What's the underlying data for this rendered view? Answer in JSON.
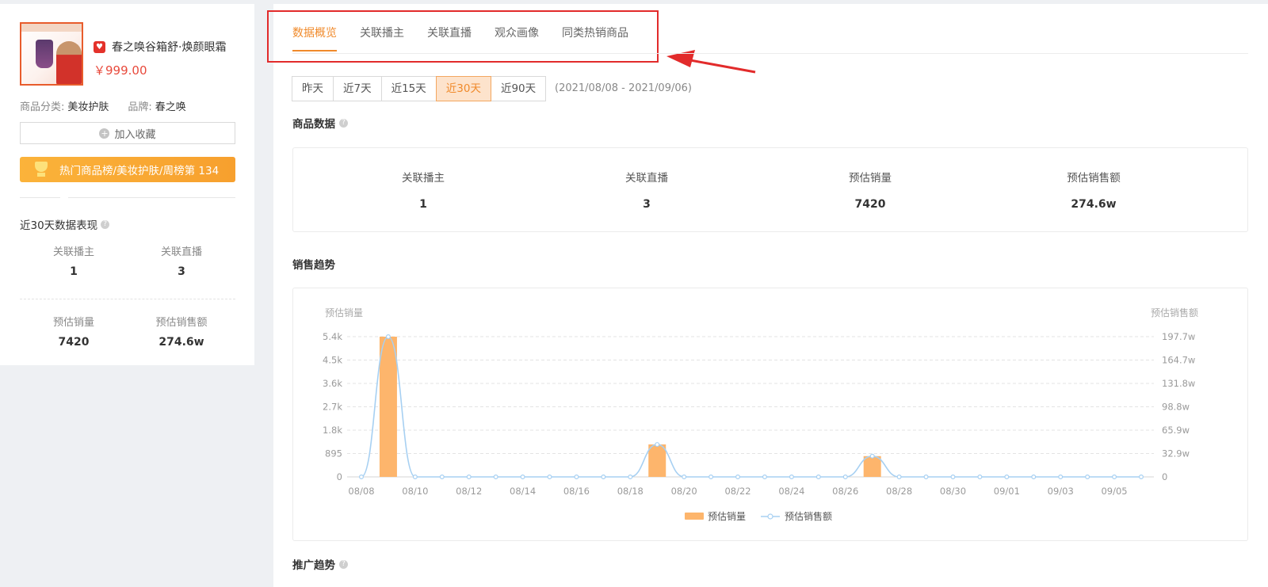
{
  "product": {
    "name": "春之唤谷箱舒·焕颜眼霜",
    "price": "￥999.00",
    "category_label": "商品分类:",
    "category_value": "美妆护肤",
    "brand_label": "品牌:",
    "brand_value": "春之唤",
    "favorite_label": "加入收藏",
    "rank_text": "热门商品榜/美妆护肤/周榜第 134"
  },
  "sidebar_stats": {
    "title": "近30天数据表现",
    "items": [
      {
        "label": "关联播主",
        "value": "1"
      },
      {
        "label": "关联直播",
        "value": "3"
      },
      {
        "label": "预估销量",
        "value": "7420"
      },
      {
        "label": "预估销售额",
        "value": "274.6w"
      }
    ]
  },
  "tabs": [
    {
      "label": "数据概览",
      "active": true
    },
    {
      "label": "关联播主",
      "active": false
    },
    {
      "label": "关联直播",
      "active": false
    },
    {
      "label": "观众画像",
      "active": false
    },
    {
      "label": "同类热销商品",
      "active": false
    }
  ],
  "date_filters": [
    {
      "label": "昨天",
      "active": false
    },
    {
      "label": "近7天",
      "active": false
    },
    {
      "label": "近15天",
      "active": false
    },
    {
      "label": "近30天",
      "active": true
    },
    {
      "label": "近90天",
      "active": false
    }
  ],
  "date_range": "(2021/08/08 - 2021/09/06)",
  "product_data": {
    "title": "商品数据",
    "items": [
      {
        "label": "关联播主",
        "value": "1"
      },
      {
        "label": "关联直播",
        "value": "3"
      },
      {
        "label": "预估销量",
        "value": "7420"
      },
      {
        "label": "预估销售额",
        "value": "274.6w"
      }
    ]
  },
  "sales_trend_title": "销售趋势",
  "promo_trend_title": "推广趋势",
  "colors": {
    "accent": "#f08a2b",
    "bar": "#fdb56c",
    "line": "#a7d0f2",
    "highlight": "#e22b2b"
  },
  "chart_data": {
    "type": "bar",
    "title": "",
    "ylabel": "预估销量",
    "ylabel_right": "预估销售额",
    "ylim": [
      0,
      5400
    ],
    "y_ticks": [
      "0",
      "895",
      "1.8k",
      "2.7k",
      "3.6k",
      "4.5k",
      "5.4k"
    ],
    "y2_ticks": [
      "0",
      "32.9w",
      "65.9w",
      "98.8w",
      "131.8w",
      "164.7w",
      "197.7w"
    ],
    "x_tick_labels": [
      "08/08",
      "08/10",
      "08/12",
      "08/14",
      "08/16",
      "08/18",
      "08/20",
      "08/22",
      "08/24",
      "08/26",
      "08/28",
      "08/30",
      "09/01",
      "09/03",
      "09/05"
    ],
    "categories": [
      "08/08",
      "08/09",
      "08/10",
      "08/11",
      "08/12",
      "08/13",
      "08/14",
      "08/15",
      "08/16",
      "08/17",
      "08/18",
      "08/19",
      "08/20",
      "08/21",
      "08/22",
      "08/23",
      "08/24",
      "08/25",
      "08/26",
      "08/27",
      "08/28",
      "08/29",
      "08/30",
      "08/31",
      "09/01",
      "09/02",
      "09/03",
      "09/04",
      "09/05",
      "09/06"
    ],
    "series": [
      {
        "name": "预估销量",
        "type": "bar",
        "values": [
          0,
          5400,
          0,
          0,
          0,
          0,
          0,
          0,
          0,
          0,
          0,
          1250,
          0,
          0,
          0,
          0,
          0,
          0,
          0,
          800,
          0,
          0,
          0,
          0,
          0,
          0,
          0,
          0,
          0,
          0,
          0
        ]
      },
      {
        "name": "预估销售额",
        "type": "line",
        "values": [
          0,
          1977000,
          0,
          0,
          0,
          0,
          0,
          0,
          0,
          0,
          0,
          457000,
          0,
          0,
          0,
          0,
          0,
          0,
          0,
          293000,
          0,
          0,
          0,
          0,
          0,
          0,
          0,
          0,
          0,
          0,
          0
        ]
      }
    ],
    "y2lim": [
      0,
      1977000
    ],
    "legend_position": "bottom",
    "grid": true
  }
}
